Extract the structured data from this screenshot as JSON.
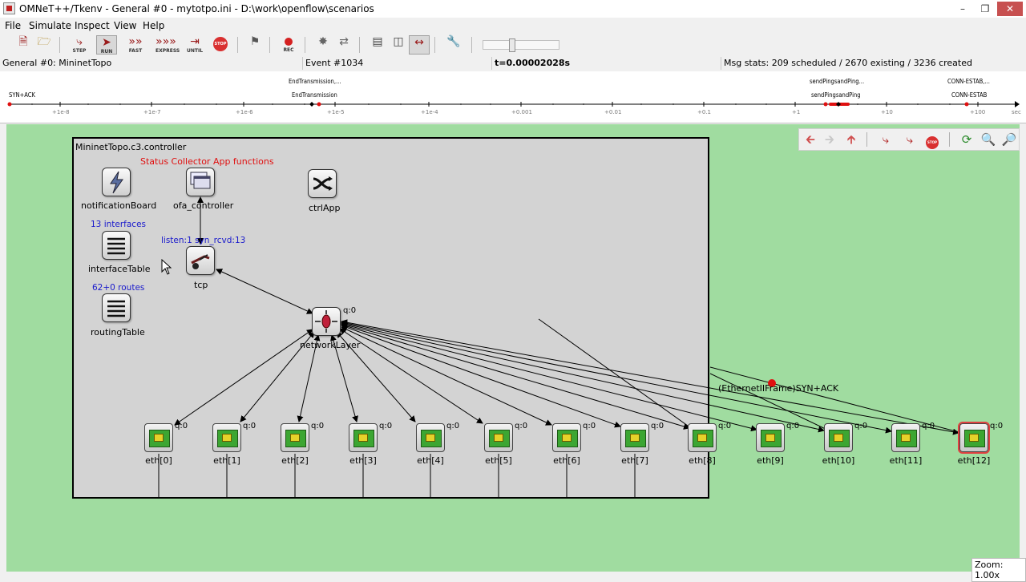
{
  "window": {
    "title": "OMNeT++/Tkenv - General #0 - mytotpo.ini - D:\\work\\openflow\\scenarios",
    "min_icon": "minimize-icon",
    "max_icon": "maximize-icon",
    "close_icon": "close-icon"
  },
  "menu": [
    "File",
    "Simulate",
    "Inspect",
    "View",
    "Help"
  ],
  "toolbar": {
    "step": "STEP",
    "run": "RUN",
    "fast": "FAST",
    "express": "EXPRESS",
    "until": "UNTIL",
    "stop": "STOP",
    "rec": "REC"
  },
  "status": {
    "config": "General #0: MininetTopo",
    "event": "Event #1034",
    "time": "t=0.00002028s",
    "msgstats": "Msg stats: 209 scheduled / 2670 existing / 3236 created"
  },
  "timeline": {
    "events": [
      {
        "label": "SYN+ACK"
      },
      {
        "label": "EndTransmission,..."
      },
      {
        "label": "EndTransmission"
      },
      {
        "label": "sendPingsandPing..."
      },
      {
        "label": "sendPingsandPing"
      },
      {
        "label": "CONN-ESTAB,..."
      },
      {
        "label": "CONN-ESTAB"
      }
    ],
    "ticks": [
      "+1e-8",
      "+1e-7",
      "+1e-6",
      "+1e-5",
      "+1e-4",
      "+0.001",
      "+0.01",
      "+0.1",
      "+1",
      "+10",
      "+100"
    ],
    "unit": "sec"
  },
  "canvas": {
    "compound_title": "MininetTopo.c3.controller",
    "status_note": "Status Collector App functions",
    "tcp_note": "listen:1 syn_rcvd:13",
    "interfaces_note": "13 interfaces",
    "routes_note": "62+0 routes",
    "packet_label": "(EthernetIIFrame)SYN+ACK",
    "zoom": "Zoom: 1.00x",
    "modules": {
      "notificationBoard": "notificationBoard",
      "ofa_controller": "ofa_controller",
      "ctrlApp": "ctrlApp",
      "interfaceTable": "interfaceTable",
      "tcp": "tcp",
      "routingTable": "routingTable",
      "networkLayer": "networkLayer",
      "networkLayer_q": "q:0"
    },
    "eth": [
      {
        "name": "eth[0]",
        "q": "q:0"
      },
      {
        "name": "eth[1]",
        "q": "q:0"
      },
      {
        "name": "eth[2]",
        "q": "q:0"
      },
      {
        "name": "eth[3]",
        "q": "q:0"
      },
      {
        "name": "eth[4]",
        "q": "q:0"
      },
      {
        "name": "eth[5]",
        "q": "q:0"
      },
      {
        "name": "eth[6]",
        "q": "q:0"
      },
      {
        "name": "eth[7]",
        "q": "q:0"
      },
      {
        "name": "eth[8]",
        "q": "q:0"
      },
      {
        "name": "eth[9]",
        "q": "q:0"
      },
      {
        "name": "eth[10]",
        "q": "q:0"
      },
      {
        "name": "eth[11]",
        "q": "q:0"
      },
      {
        "name": "eth[12]",
        "q": "q:0"
      }
    ]
  },
  "colors": {
    "canvas_bg": "#a0dca0",
    "compound_bg": "#d3d3d3",
    "note_red": "#e01010",
    "note_blue": "#1a1acc"
  }
}
